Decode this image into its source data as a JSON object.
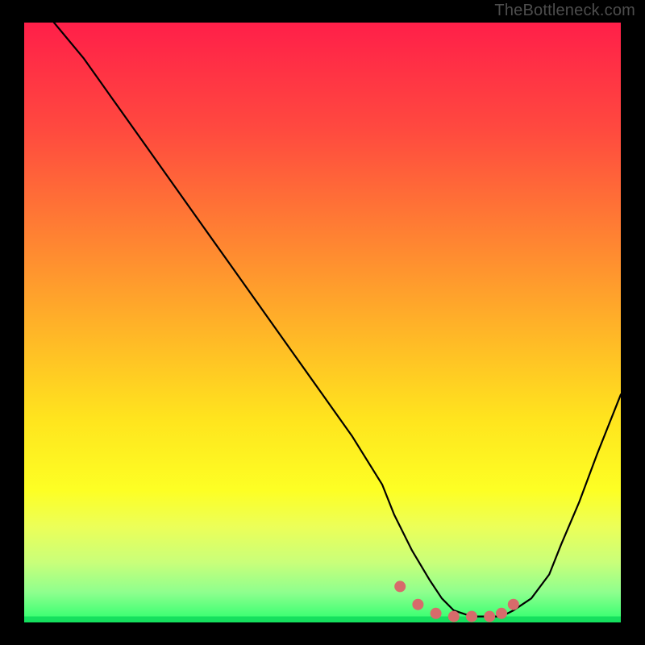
{
  "watermark": "TheBottleneck.com",
  "chart_data": {
    "type": "line",
    "title": "",
    "xlabel": "",
    "ylabel": "",
    "xlim": [
      0,
      100
    ],
    "ylim": [
      0,
      100
    ],
    "series": [
      {
        "name": "bottleneck-curve",
        "x": [
          5,
          10,
          15,
          20,
          25,
          30,
          35,
          40,
          45,
          50,
          55,
          60,
          62,
          65,
          68,
          70,
          72,
          75,
          78,
          80,
          82,
          85,
          88,
          90,
          93,
          96,
          100
        ],
        "values": [
          100,
          94,
          87,
          80,
          73,
          66,
          59,
          52,
          45,
          38,
          31,
          23,
          18,
          12,
          7,
          4,
          2,
          1,
          1,
          1,
          2,
          4,
          8,
          13,
          20,
          28,
          38
        ]
      }
    ],
    "highlight_points": {
      "name": "optimal-range",
      "x": [
        63,
        66,
        69,
        72,
        75,
        78,
        80,
        82
      ],
      "values": [
        6,
        3,
        1.5,
        1,
        1,
        1,
        1.5,
        3
      ]
    },
    "gradient_stops": [
      {
        "pct": 0,
        "color": "#ff1f49"
      },
      {
        "pct": 18,
        "color": "#ff4a3f"
      },
      {
        "pct": 36,
        "color": "#ff8332"
      },
      {
        "pct": 52,
        "color": "#ffb727"
      },
      {
        "pct": 66,
        "color": "#ffe41e"
      },
      {
        "pct": 78,
        "color": "#fdff24"
      },
      {
        "pct": 84,
        "color": "#ecff58"
      },
      {
        "pct": 90,
        "color": "#c9ff7a"
      },
      {
        "pct": 95,
        "color": "#8eff8e"
      },
      {
        "pct": 100,
        "color": "#2bff6d"
      }
    ],
    "green_band_y": 1
  }
}
